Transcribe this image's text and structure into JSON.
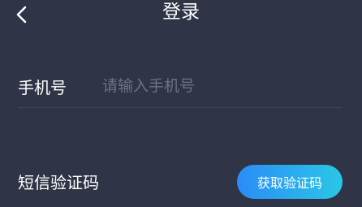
{
  "header": {
    "title": "登录",
    "back_icon": "chevron-left-icon"
  },
  "form": {
    "phone": {
      "label": "手机号",
      "value": "",
      "placeholder": "请输入手机号"
    },
    "sms_code": {
      "label": "短信验证码",
      "button_label": "获取验证码"
    }
  },
  "colors": {
    "background": "#2f3447",
    "divider": "#3f4559",
    "placeholder": "#6c7283",
    "button_gradient_start": "#2a8cf7",
    "button_gradient_end": "#2ac7e6"
  }
}
